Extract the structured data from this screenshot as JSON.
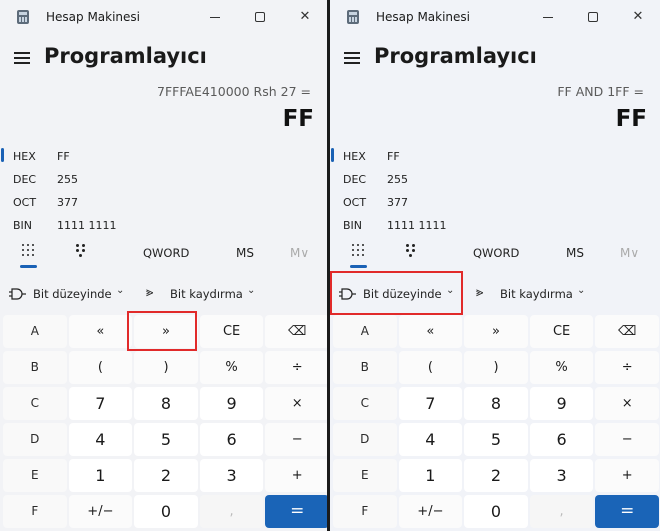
{
  "left": {
    "app_title": "Hesap Makinesi",
    "mode_title": "Programlayıcı",
    "expression": "7FFFAE410000 Rsh 27 =",
    "result": "FF",
    "radix": [
      {
        "label": "HEX",
        "value": "FF"
      },
      {
        "label": "DEC",
        "value": "255"
      },
      {
        "label": "OCT",
        "value": "377"
      },
      {
        "label": "BIN",
        "value": "1111 1111"
      }
    ],
    "word_size": "QWORD",
    "ms": "MS",
    "mv": "M∨",
    "bitwise_label": "Bit düzeyinde",
    "bitshift_label": "Bit kaydırma",
    "keys": [
      [
        "A",
        "«",
        "»",
        "CE",
        "⌫"
      ],
      [
        "B",
        "(",
        ")",
        "%",
        "÷"
      ],
      [
        "C",
        "7",
        "8",
        "9",
        "×"
      ],
      [
        "D",
        "4",
        "5",
        "6",
        "−"
      ],
      [
        "E",
        "1",
        "2",
        "3",
        "+"
      ],
      [
        "F",
        "+/−",
        "0",
        ",",
        "="
      ]
    ]
  },
  "right": {
    "app_title": "Hesap Makinesi",
    "mode_title": "Programlayıcı",
    "expression": "FF AND 1FF =",
    "result": "FF",
    "radix": [
      {
        "label": "HEX",
        "value": "FF"
      },
      {
        "label": "DEC",
        "value": "255"
      },
      {
        "label": "OCT",
        "value": "377"
      },
      {
        "label": "BIN",
        "value": "1111 1111"
      }
    ],
    "word_size": "QWORD",
    "ms": "MS",
    "mv": "M∨",
    "bitwise_label": "Bit düzeyinde",
    "bitshift_label": "Bit kaydırma",
    "keys": [
      [
        "A",
        "«",
        "»",
        "CE",
        "⌫"
      ],
      [
        "B",
        "(",
        ")",
        "%",
        "÷"
      ],
      [
        "C",
        "7",
        "8",
        "9",
        "×"
      ],
      [
        "D",
        "4",
        "5",
        "6",
        "−"
      ],
      [
        "E",
        "1",
        "2",
        "3",
        "+"
      ],
      [
        "F",
        "+/−",
        "0",
        ",",
        "="
      ]
    ]
  },
  "colors": {
    "accent": "#1a64b7",
    "highlight": "#e12a2a",
    "window_bg": "#f2f3f6"
  },
  "highlights": {
    "left": "right-shift-key",
    "right": "bitwise-dropdown"
  }
}
